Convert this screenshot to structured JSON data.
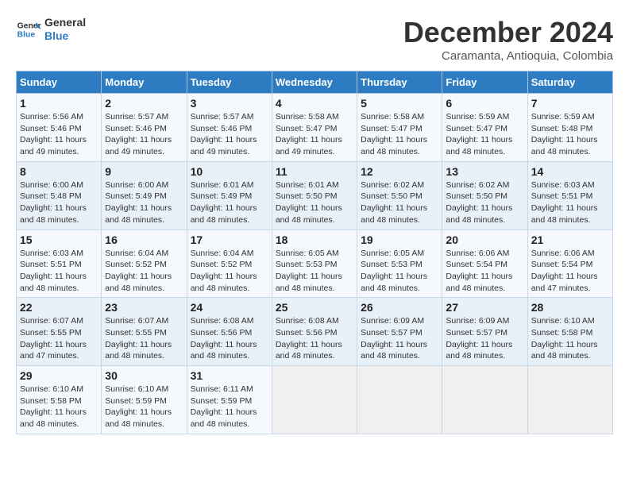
{
  "header": {
    "logo_general": "General",
    "logo_blue": "Blue",
    "month_title": "December 2024",
    "subtitle": "Caramanta, Antioquia, Colombia"
  },
  "days_of_week": [
    "Sunday",
    "Monday",
    "Tuesday",
    "Wednesday",
    "Thursday",
    "Friday",
    "Saturday"
  ],
  "weeks": [
    [
      {
        "day": "1",
        "info": "Sunrise: 5:56 AM\nSunset: 5:46 PM\nDaylight: 11 hours\nand 49 minutes."
      },
      {
        "day": "2",
        "info": "Sunrise: 5:57 AM\nSunset: 5:46 PM\nDaylight: 11 hours\nand 49 minutes."
      },
      {
        "day": "3",
        "info": "Sunrise: 5:57 AM\nSunset: 5:46 PM\nDaylight: 11 hours\nand 49 minutes."
      },
      {
        "day": "4",
        "info": "Sunrise: 5:58 AM\nSunset: 5:47 PM\nDaylight: 11 hours\nand 49 minutes."
      },
      {
        "day": "5",
        "info": "Sunrise: 5:58 AM\nSunset: 5:47 PM\nDaylight: 11 hours\nand 48 minutes."
      },
      {
        "day": "6",
        "info": "Sunrise: 5:59 AM\nSunset: 5:47 PM\nDaylight: 11 hours\nand 48 minutes."
      },
      {
        "day": "7",
        "info": "Sunrise: 5:59 AM\nSunset: 5:48 PM\nDaylight: 11 hours\nand 48 minutes."
      }
    ],
    [
      {
        "day": "8",
        "info": "Sunrise: 6:00 AM\nSunset: 5:48 PM\nDaylight: 11 hours\nand 48 minutes."
      },
      {
        "day": "9",
        "info": "Sunrise: 6:00 AM\nSunset: 5:49 PM\nDaylight: 11 hours\nand 48 minutes."
      },
      {
        "day": "10",
        "info": "Sunrise: 6:01 AM\nSunset: 5:49 PM\nDaylight: 11 hours\nand 48 minutes."
      },
      {
        "day": "11",
        "info": "Sunrise: 6:01 AM\nSunset: 5:50 PM\nDaylight: 11 hours\nand 48 minutes."
      },
      {
        "day": "12",
        "info": "Sunrise: 6:02 AM\nSunset: 5:50 PM\nDaylight: 11 hours\nand 48 minutes."
      },
      {
        "day": "13",
        "info": "Sunrise: 6:02 AM\nSunset: 5:50 PM\nDaylight: 11 hours\nand 48 minutes."
      },
      {
        "day": "14",
        "info": "Sunrise: 6:03 AM\nSunset: 5:51 PM\nDaylight: 11 hours\nand 48 minutes."
      }
    ],
    [
      {
        "day": "15",
        "info": "Sunrise: 6:03 AM\nSunset: 5:51 PM\nDaylight: 11 hours\nand 48 minutes."
      },
      {
        "day": "16",
        "info": "Sunrise: 6:04 AM\nSunset: 5:52 PM\nDaylight: 11 hours\nand 48 minutes."
      },
      {
        "day": "17",
        "info": "Sunrise: 6:04 AM\nSunset: 5:52 PM\nDaylight: 11 hours\nand 48 minutes."
      },
      {
        "day": "18",
        "info": "Sunrise: 6:05 AM\nSunset: 5:53 PM\nDaylight: 11 hours\nand 48 minutes."
      },
      {
        "day": "19",
        "info": "Sunrise: 6:05 AM\nSunset: 5:53 PM\nDaylight: 11 hours\nand 48 minutes."
      },
      {
        "day": "20",
        "info": "Sunrise: 6:06 AM\nSunset: 5:54 PM\nDaylight: 11 hours\nand 48 minutes."
      },
      {
        "day": "21",
        "info": "Sunrise: 6:06 AM\nSunset: 5:54 PM\nDaylight: 11 hours\nand 47 minutes."
      }
    ],
    [
      {
        "day": "22",
        "info": "Sunrise: 6:07 AM\nSunset: 5:55 PM\nDaylight: 11 hours\nand 47 minutes."
      },
      {
        "day": "23",
        "info": "Sunrise: 6:07 AM\nSunset: 5:55 PM\nDaylight: 11 hours\nand 48 minutes."
      },
      {
        "day": "24",
        "info": "Sunrise: 6:08 AM\nSunset: 5:56 PM\nDaylight: 11 hours\nand 48 minutes."
      },
      {
        "day": "25",
        "info": "Sunrise: 6:08 AM\nSunset: 5:56 PM\nDaylight: 11 hours\nand 48 minutes."
      },
      {
        "day": "26",
        "info": "Sunrise: 6:09 AM\nSunset: 5:57 PM\nDaylight: 11 hours\nand 48 minutes."
      },
      {
        "day": "27",
        "info": "Sunrise: 6:09 AM\nSunset: 5:57 PM\nDaylight: 11 hours\nand 48 minutes."
      },
      {
        "day": "28",
        "info": "Sunrise: 6:10 AM\nSunset: 5:58 PM\nDaylight: 11 hours\nand 48 minutes."
      }
    ],
    [
      {
        "day": "29",
        "info": "Sunrise: 6:10 AM\nSunset: 5:58 PM\nDaylight: 11 hours\nand 48 minutes."
      },
      {
        "day": "30",
        "info": "Sunrise: 6:10 AM\nSunset: 5:59 PM\nDaylight: 11 hours\nand 48 minutes."
      },
      {
        "day": "31",
        "info": "Sunrise: 6:11 AM\nSunset: 5:59 PM\nDaylight: 11 hours\nand 48 minutes."
      },
      {
        "day": "",
        "info": ""
      },
      {
        "day": "",
        "info": ""
      },
      {
        "day": "",
        "info": ""
      },
      {
        "day": "",
        "info": ""
      }
    ]
  ]
}
